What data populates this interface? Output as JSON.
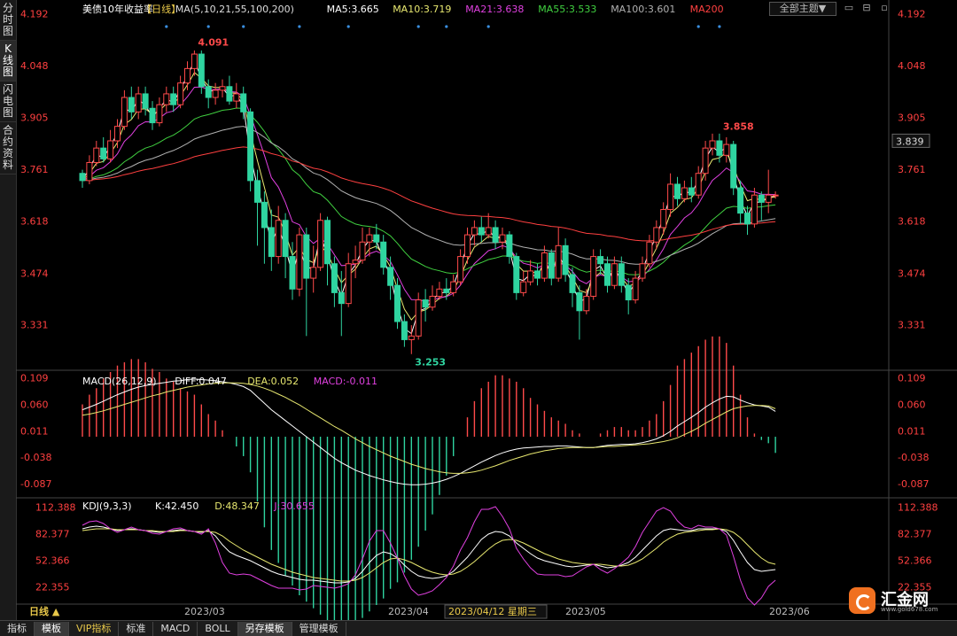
{
  "left_tabs": [
    "分时图",
    "K线图",
    "闪电图",
    "合约资料"
  ],
  "bottom_tabs": [
    "指标",
    "模板",
    "VIP指标",
    "标准",
    "MACD",
    "BOLL",
    "另存模板",
    "管理模板"
  ],
  "theme_button": "全部主题▼",
  "logo": {
    "name": "汇金网",
    "url": "www.gold678.com"
  },
  "colors": {
    "up": "#ff4a4a",
    "down": "#2fd4a0",
    "ma5": "#ffffff",
    "ma10": "#e8e870",
    "ma21": "#e040e0",
    "ma55": "#40d040",
    "ma100": "#b0b0b0",
    "ma200": "#ff4040"
  },
  "chart_data": [
    {
      "type": "candlestick",
      "header": {
        "title": "美债10年收益率",
        "period": "【日线】",
        "ma_label": "MA(5,10,21,55,100,200)",
        "ma_values": [
          {
            "label": "MA5:3.665",
            "color": "#ffffff"
          },
          {
            "label": "MA10:3.719",
            "color": "#e8e870"
          },
          {
            "label": "MA21:3.638",
            "color": "#e040e0"
          },
          {
            "label": "MA55:3.533",
            "color": "#40d040"
          },
          {
            "label": "MA100:3.601",
            "color": "#b0b0b0"
          },
          {
            "label": "MA200",
            "color": "#ff4040"
          }
        ]
      },
      "y_ticks": [
        3.331,
        3.474,
        3.618,
        3.761,
        3.905,
        4.048,
        4.192
      ],
      "ylim": [
        3.22,
        4.21
      ],
      "current_price": "3.839",
      "annotations": [
        {
          "text": "4.091",
          "value": 4.091,
          "type": "high"
        },
        {
          "text": "3.253",
          "value": 3.253,
          "type": "low"
        },
        {
          "text": "3.858",
          "value": 3.858,
          "type": "high"
        }
      ],
      "candles": [
        [
          3.75,
          3.73,
          3.76,
          3.71
        ],
        [
          3.73,
          3.78,
          3.8,
          3.72
        ],
        [
          3.78,
          3.82,
          3.84,
          3.77
        ],
        [
          3.82,
          3.79,
          3.85,
          3.78
        ],
        [
          3.79,
          3.84,
          3.87,
          3.78
        ],
        [
          3.84,
          3.88,
          3.9,
          3.82
        ],
        [
          3.88,
          3.96,
          3.98,
          3.87
        ],
        [
          3.96,
          3.92,
          3.99,
          3.9
        ],
        [
          3.92,
          3.97,
          3.99,
          3.9
        ],
        [
          3.97,
          3.93,
          3.99,
          3.91
        ],
        [
          3.93,
          3.89,
          3.95,
          3.87
        ],
        [
          3.89,
          3.94,
          3.96,
          3.88
        ],
        [
          3.94,
          3.97,
          3.99,
          3.92
        ],
        [
          3.97,
          3.94,
          3.99,
          3.92
        ],
        [
          3.94,
          4.0,
          4.02,
          3.93
        ],
        [
          4.0,
          4.04,
          4.06,
          3.98
        ],
        [
          4.04,
          4.08,
          4.09,
          4.02
        ],
        [
          4.08,
          3.99,
          4.09,
          3.97
        ],
        [
          3.99,
          3.96,
          4.01,
          3.93
        ],
        [
          3.96,
          3.98,
          4.0,
          3.94
        ],
        [
          3.98,
          3.99,
          4.01,
          3.96
        ],
        [
          3.99,
          3.95,
          4.02,
          3.94
        ],
        [
          3.95,
          3.97,
          4.0,
          3.93
        ],
        [
          3.97,
          3.92,
          3.99,
          3.9
        ],
        [
          3.92,
          3.73,
          3.93,
          3.7
        ],
        [
          3.73,
          3.67,
          3.76,
          3.55
        ],
        [
          3.67,
          3.6,
          3.7,
          3.5
        ],
        [
          3.6,
          3.52,
          3.65,
          3.48
        ],
        [
          3.52,
          3.62,
          3.66,
          3.5
        ],
        [
          3.62,
          3.52,
          3.64,
          3.46
        ],
        [
          3.52,
          3.43,
          3.56,
          3.4
        ],
        [
          3.43,
          3.58,
          3.6,
          3.41
        ],
        [
          3.58,
          3.46,
          3.6,
          3.3
        ],
        [
          3.46,
          3.49,
          3.55,
          3.42
        ],
        [
          3.49,
          3.62,
          3.64,
          3.48
        ],
        [
          3.62,
          3.5,
          3.63,
          3.44
        ],
        [
          3.5,
          3.42,
          3.52,
          3.38
        ],
        [
          3.42,
          3.39,
          3.48,
          3.3
        ],
        [
          3.39,
          3.5,
          3.53,
          3.38
        ],
        [
          3.5,
          3.51,
          3.55,
          3.46
        ],
        [
          3.51,
          3.56,
          3.6,
          3.5
        ],
        [
          3.56,
          3.58,
          3.6,
          3.52
        ],
        [
          3.58,
          3.56,
          3.61,
          3.54
        ],
        [
          3.56,
          3.49,
          3.58,
          3.47
        ],
        [
          3.49,
          3.44,
          3.52,
          3.4
        ],
        [
          3.44,
          3.34,
          3.46,
          3.32
        ],
        [
          3.34,
          3.29,
          3.36,
          3.27
        ],
        [
          3.29,
          3.3,
          3.33,
          3.25
        ],
        [
          3.3,
          3.4,
          3.42,
          3.29
        ],
        [
          3.4,
          3.38,
          3.43,
          3.34
        ],
        [
          3.38,
          3.41,
          3.44,
          3.37
        ],
        [
          3.41,
          3.43,
          3.45,
          3.4
        ],
        [
          3.43,
          3.42,
          3.46,
          3.4
        ],
        [
          3.42,
          3.45,
          3.47,
          3.41
        ],
        [
          3.45,
          3.52,
          3.54,
          3.44
        ],
        [
          3.52,
          3.58,
          3.6,
          3.5
        ],
        [
          3.58,
          3.6,
          3.62,
          3.55
        ],
        [
          3.6,
          3.58,
          3.63,
          3.56
        ],
        [
          3.58,
          3.6,
          3.64,
          3.57
        ],
        [
          3.6,
          3.56,
          3.62,
          3.54
        ],
        [
          3.56,
          3.58,
          3.6,
          3.54
        ],
        [
          3.58,
          3.52,
          3.59,
          3.5
        ],
        [
          3.52,
          3.42,
          3.53,
          3.4
        ],
        [
          3.42,
          3.45,
          3.48,
          3.41
        ],
        [
          3.45,
          3.48,
          3.51,
          3.44
        ],
        [
          3.48,
          3.46,
          3.5,
          3.44
        ],
        [
          3.46,
          3.53,
          3.55,
          3.45
        ],
        [
          3.53,
          3.46,
          3.54,
          3.44
        ],
        [
          3.46,
          3.55,
          3.6,
          3.45
        ],
        [
          3.55,
          3.47,
          3.57,
          3.45
        ],
        [
          3.47,
          3.42,
          3.49,
          3.38
        ],
        [
          3.42,
          3.37,
          3.44,
          3.29
        ],
        [
          3.37,
          3.41,
          3.43,
          3.36
        ],
        [
          3.41,
          3.52,
          3.54,
          3.4
        ],
        [
          3.52,
          3.5,
          3.54,
          3.47
        ],
        [
          3.5,
          3.44,
          3.52,
          3.42
        ],
        [
          3.44,
          3.5,
          3.52,
          3.43
        ],
        [
          3.5,
          3.44,
          3.52,
          3.42
        ],
        [
          3.44,
          3.4,
          3.46,
          3.36
        ],
        [
          3.4,
          3.46,
          3.48,
          3.39
        ],
        [
          3.46,
          3.5,
          3.52,
          3.45
        ],
        [
          3.5,
          3.56,
          3.58,
          3.49
        ],
        [
          3.56,
          3.6,
          3.62,
          3.54
        ],
        [
          3.6,
          3.65,
          3.67,
          3.58
        ],
        [
          3.65,
          3.72,
          3.75,
          3.63
        ],
        [
          3.72,
          3.68,
          3.74,
          3.66
        ],
        [
          3.68,
          3.71,
          3.73,
          3.67
        ],
        [
          3.71,
          3.69,
          3.74,
          3.67
        ],
        [
          3.69,
          3.75,
          3.77,
          3.68
        ],
        [
          3.75,
          3.82,
          3.84,
          3.73
        ],
        [
          3.82,
          3.84,
          3.86,
          3.8
        ],
        [
          3.84,
          3.8,
          3.86,
          3.78
        ],
        [
          3.8,
          3.83,
          3.85,
          3.78
        ],
        [
          3.83,
          3.71,
          3.84,
          3.69
        ],
        [
          3.71,
          3.64,
          3.73,
          3.61
        ],
        [
          3.64,
          3.61,
          3.66,
          3.58
        ],
        [
          3.61,
          3.69,
          3.71,
          3.6
        ],
        [
          3.69,
          3.67,
          3.7,
          3.62
        ],
        [
          3.67,
          3.69,
          3.76,
          3.64
        ],
        [
          3.69,
          3.69,
          3.7,
          3.68
        ]
      ],
      "x_labels": [
        "2023/03",
        "2023/04",
        "2023/05",
        "2023/06"
      ]
    },
    {
      "type": "bar",
      "header": {
        "name": "MACD(26,12,9)",
        "values": [
          {
            "label": "DIFF:0.047",
            "color": "#ffffff"
          },
          {
            "label": "DEA:0.052",
            "color": "#e8e870"
          },
          {
            "label": "MACD:-0.011",
            "color": "#e040e0"
          }
        ]
      },
      "y_ticks": [
        -0.087,
        -0.038,
        0.011,
        0.06,
        0.109
      ],
      "ylim": [
        -0.11,
        0.12
      ],
      "diff": [
        0.05,
        0.055,
        0.06,
        0.066,
        0.072,
        0.078,
        0.083,
        0.088,
        0.092,
        0.095,
        0.097,
        0.099,
        0.101,
        0.103,
        0.104,
        0.106,
        0.107,
        0.106,
        0.105,
        0.104,
        0.102,
        0.1,
        0.097,
        0.093,
        0.086,
        0.074,
        0.062,
        0.05,
        0.04,
        0.03,
        0.02,
        0.01,
        0.0,
        -0.01,
        -0.02,
        -0.03,
        -0.04,
        -0.048,
        -0.055,
        -0.062,
        -0.067,
        -0.072,
        -0.076,
        -0.08,
        -0.083,
        -0.086,
        -0.088,
        -0.089,
        -0.089,
        -0.088,
        -0.086,
        -0.083,
        -0.079,
        -0.074,
        -0.068,
        -0.061,
        -0.054,
        -0.047,
        -0.041,
        -0.035,
        -0.03,
        -0.026,
        -0.023,
        -0.021,
        -0.02,
        -0.019,
        -0.018,
        -0.018,
        -0.017,
        -0.017,
        -0.018,
        -0.019,
        -0.02,
        -0.02,
        -0.018,
        -0.016,
        -0.015,
        -0.014,
        -0.014,
        -0.013,
        -0.011,
        -0.008,
        -0.004,
        0.002,
        0.01,
        0.02,
        0.028,
        0.036,
        0.045,
        0.055,
        0.063,
        0.07,
        0.075,
        0.074,
        0.068,
        0.063,
        0.059,
        0.057,
        0.055,
        0.047
      ],
      "dea": [
        0.04,
        0.042,
        0.045,
        0.048,
        0.052,
        0.056,
        0.06,
        0.064,
        0.068,
        0.072,
        0.076,
        0.079,
        0.083,
        0.086,
        0.089,
        0.092,
        0.094,
        0.096,
        0.098,
        0.099,
        0.1,
        0.1,
        0.1,
        0.099,
        0.097,
        0.094,
        0.09,
        0.085,
        0.079,
        0.073,
        0.066,
        0.059,
        0.051,
        0.043,
        0.035,
        0.027,
        0.019,
        0.012,
        0.004,
        -0.004,
        -0.011,
        -0.018,
        -0.024,
        -0.03,
        -0.036,
        -0.041,
        -0.046,
        -0.051,
        -0.055,
        -0.059,
        -0.062,
        -0.065,
        -0.067,
        -0.068,
        -0.068,
        -0.067,
        -0.065,
        -0.062,
        -0.058,
        -0.054,
        -0.049,
        -0.044,
        -0.04,
        -0.036,
        -0.032,
        -0.029,
        -0.026,
        -0.024,
        -0.022,
        -0.021,
        -0.02,
        -0.02,
        -0.02,
        -0.02,
        -0.019,
        -0.018,
        -0.018,
        -0.017,
        -0.016,
        -0.015,
        -0.014,
        -0.013,
        -0.011,
        -0.009,
        -0.006,
        -0.002,
        0.004,
        0.01,
        0.017,
        0.025,
        0.032,
        0.039,
        0.046,
        0.052,
        0.055,
        0.057,
        0.058,
        0.058,
        0.057,
        0.052
      ],
      "x_labels": []
    },
    {
      "type": "line",
      "header": {
        "name": "KDJ(9,3,3)",
        "values": [
          {
            "label": "K:42.450",
            "color": "#ffffff"
          },
          {
            "label": "D:48.347",
            "color": "#e8e870"
          },
          {
            "label": "J:30.655",
            "color": "#e040e0"
          }
        ]
      },
      "y_ticks": [
        22.355,
        52.366,
        82.377,
        112.388
      ],
      "ylim": [
        5,
        120
      ],
      "k": [
        88,
        90,
        91,
        90,
        88,
        86,
        87,
        88,
        87,
        86,
        85,
        84,
        85,
        86,
        87,
        86,
        85,
        84,
        86,
        80,
        70,
        62,
        58,
        55,
        52,
        48,
        44,
        40,
        37,
        35,
        33,
        31,
        30,
        30,
        29,
        28,
        27,
        27,
        28,
        32,
        40,
        50,
        58,
        62,
        60,
        55,
        47,
        40,
        35,
        33,
        32,
        33,
        35,
        40,
        48,
        56,
        66,
        76,
        82,
        85,
        84,
        80,
        72,
        66,
        60,
        55,
        52,
        50,
        48,
        46,
        45,
        46,
        47,
        48,
        46,
        44,
        45,
        47,
        50,
        56,
        64,
        72,
        80,
        86,
        88,
        87,
        86,
        86,
        88,
        88,
        88,
        88,
        85,
        75,
        62,
        50,
        42,
        40,
        41,
        42
      ],
      "d": [
        86,
        87,
        88,
        88,
        88,
        87,
        87,
        87,
        87,
        86,
        86,
        85,
        85,
        85,
        86,
        86,
        85,
        85,
        85,
        84,
        80,
        74,
        69,
        64,
        60,
        56,
        52,
        48,
        45,
        42,
        39,
        37,
        35,
        33,
        32,
        31,
        30,
        29,
        29,
        30,
        33,
        38,
        44,
        50,
        54,
        55,
        53,
        50,
        46,
        42,
        39,
        37,
        36,
        37,
        40,
        45,
        51,
        58,
        65,
        71,
        75,
        76,
        75,
        72,
        68,
        64,
        60,
        57,
        54,
        52,
        50,
        49,
        48,
        48,
        48,
        47,
        46,
        46,
        47,
        50,
        54,
        60,
        66,
        73,
        78,
        82,
        84,
        85,
        86,
        87,
        87,
        88,
        87,
        84,
        78,
        70,
        62,
        55,
        50,
        48
      ],
      "j": [
        92,
        96,
        97,
        94,
        88,
        84,
        87,
        90,
        87,
        86,
        83,
        82,
        85,
        88,
        89,
        86,
        85,
        82,
        88,
        72,
        50,
        38,
        36,
        37,
        36,
        32,
        28,
        24,
        21,
        21,
        21,
        19,
        20,
        24,
        23,
        22,
        21,
        23,
        26,
        36,
        54,
        74,
        86,
        86,
        72,
        55,
        35,
        20,
        13,
        15,
        18,
        25,
        33,
        46,
        64,
        78,
        96,
        110,
        110,
        113,
        102,
        88,
        66,
        54,
        44,
        37,
        36,
        36,
        36,
        34,
        35,
        40,
        45,
        48,
        42,
        38,
        43,
        49,
        56,
        68,
        84,
        96,
        108,
        112,
        108,
        97,
        90,
        88,
        92,
        90,
        90,
        88,
        81,
        57,
        30,
        10,
        2,
        10,
        23,
        30
      ],
      "x_labels": [
        "2023/03",
        "2023/04",
        "2023/05",
        "2023/06"
      ],
      "cursor_date": "2023/04/12 星期三",
      "period_label": "日线 ▲"
    }
  ]
}
